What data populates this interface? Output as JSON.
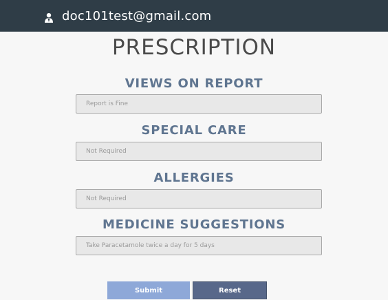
{
  "header": {
    "user_email": "doc101test@gmail.com",
    "user_icon": "user-icon",
    "background_color": "#2f3d47"
  },
  "form": {
    "title": "PRESCRIPTION",
    "sections": [
      {
        "heading": "VIEWS ON REPORT",
        "value": "Report is Fine"
      },
      {
        "heading": "SPECIAL CARE",
        "value": "Not Required"
      },
      {
        "heading": "ALLERGIES",
        "value": "Not Required"
      },
      {
        "heading": "MEDICINE SUGGESTIONS",
        "value": "Take Paracetamole twice a day for 5 days"
      }
    ],
    "submit_label": "Submit",
    "reset_label": "Reset"
  },
  "colors": {
    "heading": "#5f7590",
    "submit_button": "#8ea8d8",
    "reset_button": "#58688a"
  }
}
